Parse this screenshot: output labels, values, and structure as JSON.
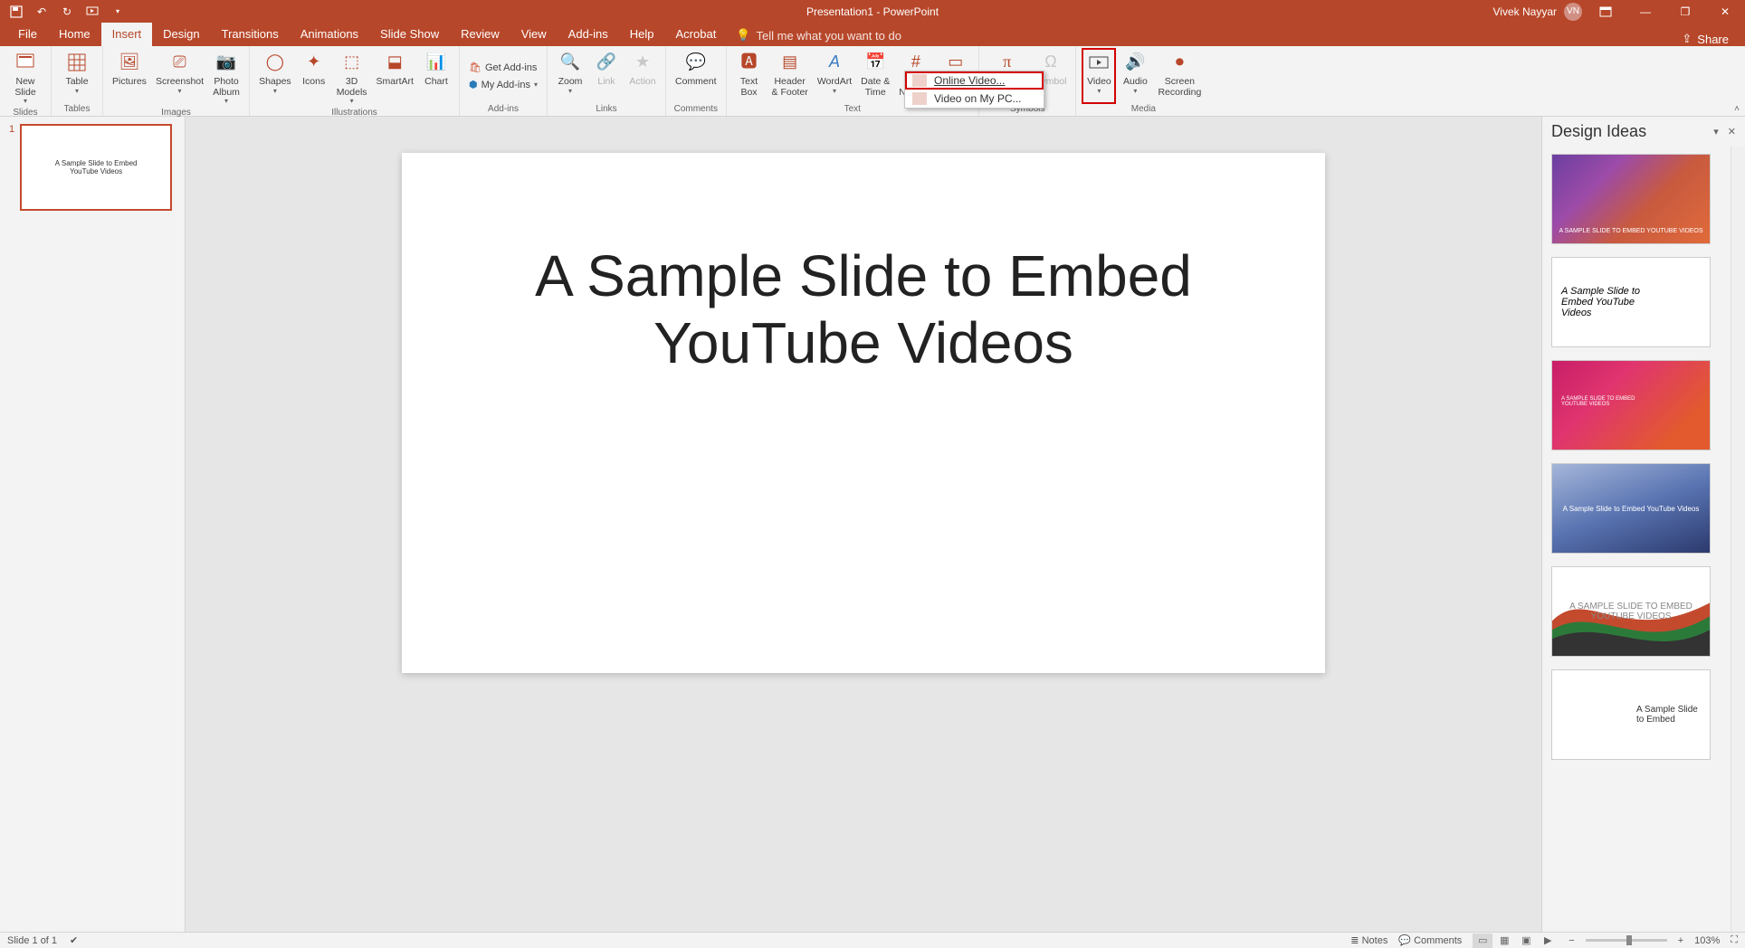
{
  "app": {
    "title": "Presentation1 - PowerPoint",
    "user": "Vivek Nayyar",
    "user_initials": "VN"
  },
  "share": "Share",
  "tabs": [
    "File",
    "Home",
    "Insert",
    "Design",
    "Transitions",
    "Animations",
    "Slide Show",
    "Review",
    "View",
    "Add-ins",
    "Help",
    "Acrobat"
  ],
  "active_tab": "Insert",
  "tellme": "Tell me what you want to do",
  "ribbon": {
    "slides": {
      "label": "Slides",
      "new_slide": "New\nSlide"
    },
    "tables": {
      "label": "Tables",
      "table": "Table"
    },
    "images": {
      "label": "Images",
      "pictures": "Pictures",
      "screenshot": "Screenshot",
      "photo_album": "Photo\nAlbum"
    },
    "illustrations": {
      "label": "Illustrations",
      "shapes": "Shapes",
      "icons": "Icons",
      "models": "3D\nModels",
      "smartart": "SmartArt",
      "chart": "Chart"
    },
    "addins": {
      "label": "Add-ins",
      "get": "Get Add-ins",
      "my": "My Add-ins"
    },
    "links": {
      "label": "Links",
      "zoom": "Zoom",
      "link": "Link",
      "action": "Action"
    },
    "comments": {
      "label": "Comments",
      "comment": "Comment"
    },
    "text": {
      "label": "Text",
      "textbox": "Text\nBox",
      "header": "Header\n& Footer",
      "wordart": "WordArt",
      "datetime": "Date &\nTime",
      "slidenum": "Slide\nNumber",
      "object": "Object"
    },
    "symbols": {
      "label": "Symbols",
      "equation": "Equation",
      "symbol": "Symbol"
    },
    "media": {
      "label": "Media",
      "video": "Video",
      "audio": "Audio",
      "screenrec": "Screen\nRecording"
    }
  },
  "video_menu": {
    "online": "Online Video...",
    "onpc": "Video on My PC..."
  },
  "slide": {
    "number": "1",
    "title": "A Sample Slide to Embed\nYouTube Videos",
    "thumb_title": "A Sample Slide to Embed\nYouTube Videos"
  },
  "design_ideas": {
    "title": "Design Ideas",
    "cards": [
      "A SAMPLE SLIDE TO EMBED YOUTUBE VIDEOS",
      "A Sample Slide to Embed YouTube Videos",
      "A SAMPLE SLIDE TO EMBED YOUTUBE VIDEOS",
      "A Sample Slide to Embed YouTube Videos",
      "A SAMPLE SLIDE TO EMBED YOUTUBE VIDEOS",
      "A Sample Slide to Embed"
    ]
  },
  "statusbar": {
    "slide": "Slide 1 of 1",
    "notes": "Notes",
    "comments": "Comments",
    "zoom": "103%"
  }
}
